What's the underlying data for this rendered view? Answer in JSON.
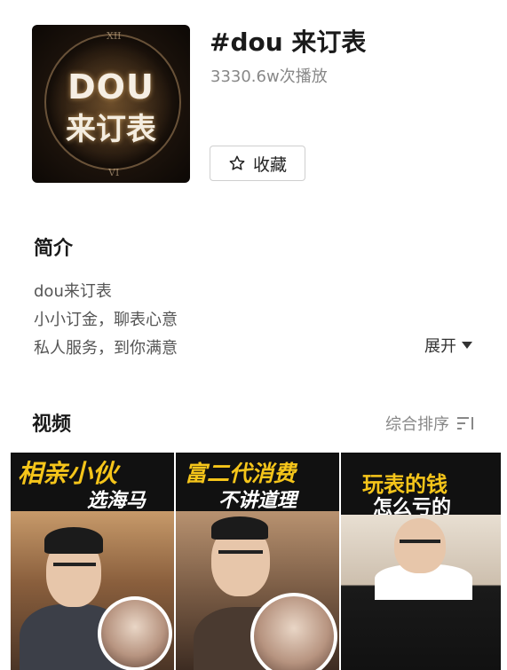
{
  "topic": {
    "cover_line1": "DOU",
    "cover_line2": "来订表",
    "title": "#dou 来订表",
    "plays": "3330.6w次播放",
    "favorite_label": "收藏"
  },
  "intro": {
    "heading": "简介",
    "lines": [
      "dou来订表",
      "小小订金，聊表心意",
      "私人服务，到你满意"
    ],
    "expand_label": "展开"
  },
  "videos": {
    "heading": "视频",
    "sort_label": "综合排序",
    "items": [
      {
        "caption_top": "相亲小伙",
        "caption_bottom": "选海马"
      },
      {
        "caption_top": "富二代消费",
        "caption_bottom": "不讲道理"
      },
      {
        "caption_top": "玩表的钱",
        "caption_bottom": "怎么亏的"
      }
    ]
  },
  "icons": {
    "favorite": "star-outline-icon",
    "expand": "triangle-down-icon",
    "sort": "sort-lines-icon"
  },
  "colors": {
    "caption_yellow": "#f5c51a",
    "caption_white": "#ffffff",
    "text_gray": "#888888"
  }
}
